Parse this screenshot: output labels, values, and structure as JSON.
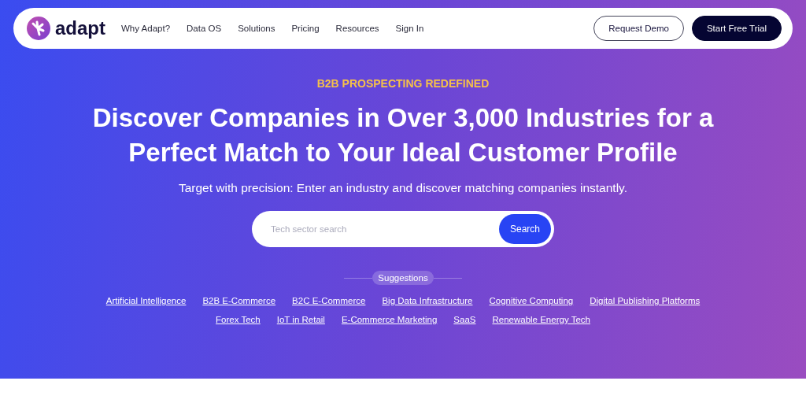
{
  "nav": {
    "brand": "adapt",
    "links": [
      "Why Adapt?",
      "Data OS",
      "Solutions",
      "Pricing",
      "Resources",
      "Sign In"
    ],
    "buttons": [
      {
        "label": "Request Demo",
        "kind": "outline"
      },
      {
        "label": "Start Free Trial",
        "kind": "solid"
      }
    ]
  },
  "hero": {
    "eyebrow": "B2B PROSPECTING REDEFINED",
    "title": "Discover Companies in Over 3,000 Industries for a Perfect Match to Your Ideal Customer Profile",
    "subtitle": "Target with precision: Enter an industry and discover matching companies instantly.",
    "search": {
      "placeholder": "Tech sector search",
      "button": "Search"
    },
    "suggestions_label": "Suggestions",
    "suggestion_rows": [
      [
        "Artificial Intelligence",
        "B2B E-Commerce",
        "B2C E-Commerce",
        "Big Data Infrastructure",
        "Cognitive Computing",
        "Digital Publishing Platforms"
      ],
      [
        "Forex Tech",
        "IoT in Retail",
        "E-Commerce Marketing",
        "SaaS",
        "Renewable Energy Tech"
      ]
    ]
  }
}
